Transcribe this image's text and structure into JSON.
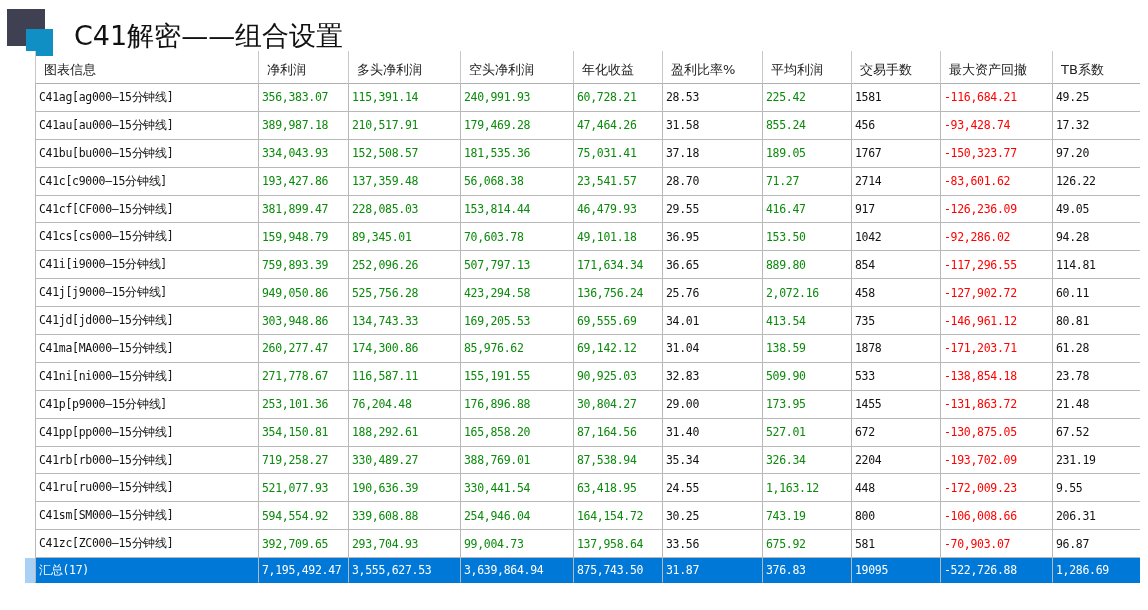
{
  "title": "C41解密——组合设置",
  "columns": [
    {
      "label": "图表信息",
      "kind": "plain"
    },
    {
      "label": "净利润",
      "kind": "gain"
    },
    {
      "label": "多头净利润",
      "kind": "gain"
    },
    {
      "label": "空头净利润",
      "kind": "gain"
    },
    {
      "label": "年化收益",
      "kind": "gain"
    },
    {
      "label": "盈利比率%",
      "kind": "plain"
    },
    {
      "label": "平均利润",
      "kind": "gain"
    },
    {
      "label": "交易手数",
      "kind": "plain"
    },
    {
      "label": "最大资产回撤",
      "kind": "loss"
    },
    {
      "label": "TB系数",
      "kind": "plain"
    }
  ],
  "rows": [
    {
      "selected": false,
      "cells": [
        "C41ag[ag000—15分钟线]",
        "356,383.07",
        "115,391.14",
        "240,991.93",
        "60,728.21",
        "28.53",
        "225.42",
        "1581",
        "-116,684.21",
        "49.25"
      ]
    },
    {
      "selected": false,
      "cells": [
        "C41au[au000—15分钟线]",
        "389,987.18",
        "210,517.91",
        "179,469.28",
        "47,464.26",
        "31.58",
        "855.24",
        "456",
        "-93,428.74",
        "17.32"
      ]
    },
    {
      "selected": false,
      "cells": [
        "C41bu[bu000—15分钟线]",
        "334,043.93",
        "152,508.57",
        "181,535.36",
        "75,031.41",
        "37.18",
        "189.05",
        "1767",
        "-150,323.77",
        "97.20"
      ]
    },
    {
      "selected": false,
      "cells": [
        "C41c[c9000—15分钟线]",
        "193,427.86",
        "137,359.48",
        "56,068.38",
        "23,541.57",
        "28.70",
        "71.27",
        "2714",
        "-83,601.62",
        "126.22"
      ]
    },
    {
      "selected": false,
      "cells": [
        "C41cf[CF000—15分钟线]",
        "381,899.47",
        "228,085.03",
        "153,814.44",
        "46,479.93",
        "29.55",
        "416.47",
        "917",
        "-126,236.09",
        "49.05"
      ]
    },
    {
      "selected": false,
      "cells": [
        "C41cs[cs000—15分钟线]",
        "159,948.79",
        "89,345.01",
        "70,603.78",
        "49,101.18",
        "36.95",
        "153.50",
        "1042",
        "-92,286.02",
        "94.28"
      ]
    },
    {
      "selected": false,
      "cells": [
        "C41i[i9000—15分钟线]",
        "759,893.39",
        "252,096.26",
        "507,797.13",
        "171,634.34",
        "36.65",
        "889.80",
        "854",
        "-117,296.55",
        "114.81"
      ]
    },
    {
      "selected": false,
      "cells": [
        "C41j[j9000—15分钟线]",
        "949,050.86",
        "525,756.28",
        "423,294.58",
        "136,756.24",
        "25.76",
        "2,072.16",
        "458",
        "-127,902.72",
        "60.11"
      ]
    },
    {
      "selected": false,
      "cells": [
        "C41jd[jd000—15分钟线]",
        "303,948.86",
        "134,743.33",
        "169,205.53",
        "69,555.69",
        "34.01",
        "413.54",
        "735",
        "-146,961.12",
        "80.81"
      ]
    },
    {
      "selected": false,
      "cells": [
        "C41ma[MA000—15分钟线]",
        "260,277.47",
        "174,300.86",
        "85,976.62",
        "69,142.12",
        "31.04",
        "138.59",
        "1878",
        "-171,203.71",
        "61.28"
      ]
    },
    {
      "selected": false,
      "cells": [
        "C41ni[ni000—15分钟线]",
        "271,778.67",
        "116,587.11",
        "155,191.55",
        "90,925.03",
        "32.83",
        "509.90",
        "533",
        "-138,854.18",
        "23.78"
      ]
    },
    {
      "selected": false,
      "cells": [
        "C41p[p9000—15分钟线]",
        "253,101.36",
        "76,204.48",
        "176,896.88",
        "30,804.27",
        "29.00",
        "173.95",
        "1455",
        "-131,863.72",
        "21.48"
      ]
    },
    {
      "selected": false,
      "cells": [
        "C41pp[pp000—15分钟线]",
        "354,150.81",
        "188,292.61",
        "165,858.20",
        "87,164.56",
        "31.40",
        "527.01",
        "672",
        "-130,875.05",
        "67.52"
      ]
    },
    {
      "selected": false,
      "cells": [
        "C41rb[rb000—15分钟线]",
        "719,258.27",
        "330,489.27",
        "388,769.01",
        "87,538.94",
        "35.34",
        "326.34",
        "2204",
        "-193,702.09",
        "231.19"
      ]
    },
    {
      "selected": false,
      "cells": [
        "C41ru[ru000—15分钟线]",
        "521,077.93",
        "190,636.39",
        "330,441.54",
        "63,418.95",
        "24.55",
        "1,163.12",
        "448",
        "-172,009.23",
        "9.55"
      ]
    },
    {
      "selected": false,
      "cells": [
        "C41sm[SM000—15分钟线]",
        "594,554.92",
        "339,608.88",
        "254,946.04",
        "164,154.72",
        "30.25",
        "743.19",
        "800",
        "-106,008.66",
        "206.31"
      ]
    },
    {
      "selected": false,
      "cells": [
        "C41zc[ZC000—15分钟线]",
        "392,709.65",
        "293,704.93",
        "99,004.73",
        "137,958.64",
        "33.56",
        "675.92",
        "581",
        "-70,903.07",
        "96.87"
      ]
    },
    {
      "selected": true,
      "cells": [
        "汇总(17)",
        "7,195,492.47",
        "3,555,627.53",
        "3,639,864.94",
        "875,743.50",
        "31.87",
        "376.83",
        "19095",
        "-522,726.88",
        "1,286.69"
      ]
    }
  ]
}
